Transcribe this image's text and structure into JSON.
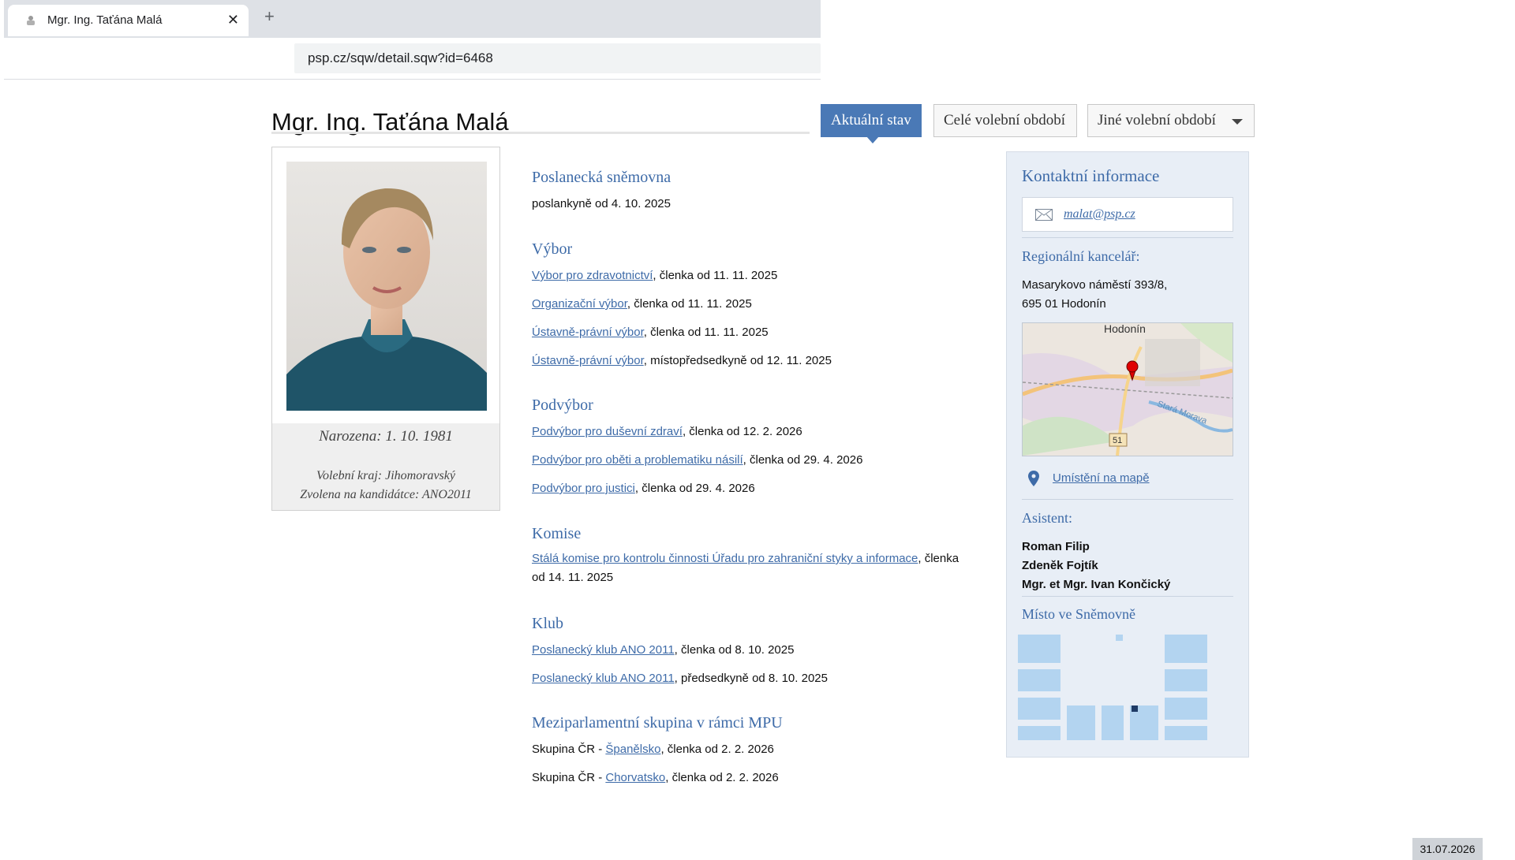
{
  "browser": {
    "tab_title": "Mgr. Ing. Taťána Malá",
    "new_tab": "+",
    "close": "✕",
    "url": "psp.cz/sqw/detail.sqw?id=6468"
  },
  "page": {
    "title": "Mgr. Ing. Taťána Malá",
    "tabs": {
      "current": "Aktuální stav",
      "full_term": "Celé volební období",
      "other_term": "Jiné volební období"
    }
  },
  "profile": {
    "born": "Narozena: 1. 10. 1981",
    "district": "Volební kraj: Jihomoravský",
    "party": "Zvolena na kandidátce: ANO2011"
  },
  "sections": {
    "chamber": {
      "heading": "Poslanecká sněmovna",
      "text": "poslankyně od 4. 10. 2025"
    },
    "committee": {
      "heading": "Výbor",
      "items": [
        {
          "link": "Výbor pro zdravotnictví",
          "text": ", členka od 11. 11. 2025"
        },
        {
          "link": "Organizační výbor",
          "text": ", členka od 11. 11. 2025"
        },
        {
          "link": "Ústavně-právní výbor",
          "text": ", členka od 11. 11. 2025"
        },
        {
          "link": "Ústavně-právní výbor",
          "text": ", místopředsedkyně od 12. 11. 2025"
        }
      ]
    },
    "subcommittee": {
      "heading": "Podvýbor",
      "items": [
        {
          "link": "Podvýbor pro duševní zdraví",
          "text": ", členka od 12. 2. 2026"
        },
        {
          "link": "Podvýbor pro oběti a problematiku násilí",
          "text": ", členka od 29. 4. 2026"
        },
        {
          "link": "Podvýbor pro justici",
          "text": ", členka od 29. 4. 2026"
        }
      ]
    },
    "commission": {
      "heading": "Komise",
      "items": [
        {
          "link": "Stálá komise pro kontrolu činnosti Úřadu pro zahraniční styky a informace",
          "text": ", členka od 14. 11. 2025"
        }
      ]
    },
    "club": {
      "heading": "Klub",
      "items": [
        {
          "link": "Poslanecký klub ANO 2011",
          "text": ", členka od 8. 10. 2025"
        },
        {
          "link": "Poslanecký klub ANO 2011",
          "text": ", předsedkyně od 8. 10. 2025"
        }
      ]
    },
    "ipu": {
      "heading": "Meziparlamentní skupina v rámci MPU",
      "items": [
        {
          "prefix": "Skupina ČR - ",
          "link": "Španělsko",
          "text": ", členka od 2. 2. 2026"
        },
        {
          "prefix": "Skupina ČR - ",
          "link": "Chorvatsko",
          "text": ", členka od 2. 2. 2026"
        }
      ]
    }
  },
  "contact": {
    "heading": "Kontaktní informace",
    "email": "malat@psp.cz",
    "regional_heading": "Regionální kancelář:",
    "address_line1": "Masarykovo náměstí 393/8,",
    "address_line2": "695 01  Hodonín",
    "map_city": "Hodonín",
    "map_river": "Stará Morava",
    "map_road": "51",
    "map_link": "Umístění na mapě",
    "assistant_heading": "Asistent:",
    "assistants": [
      "Roman Filip",
      "Zdeněk Fojtík",
      "Mgr. et Mgr. Ivan Končický"
    ],
    "seat_heading": "Místo ve Sněmovně"
  },
  "date": "31.07.2026",
  "colors": {
    "accent": "#4a79b6",
    "link": "#3e6ba8",
    "panel_bg": "#e8eef6",
    "seat_block": "#b3d4f0",
    "seat_marker": "#1f3b66"
  }
}
